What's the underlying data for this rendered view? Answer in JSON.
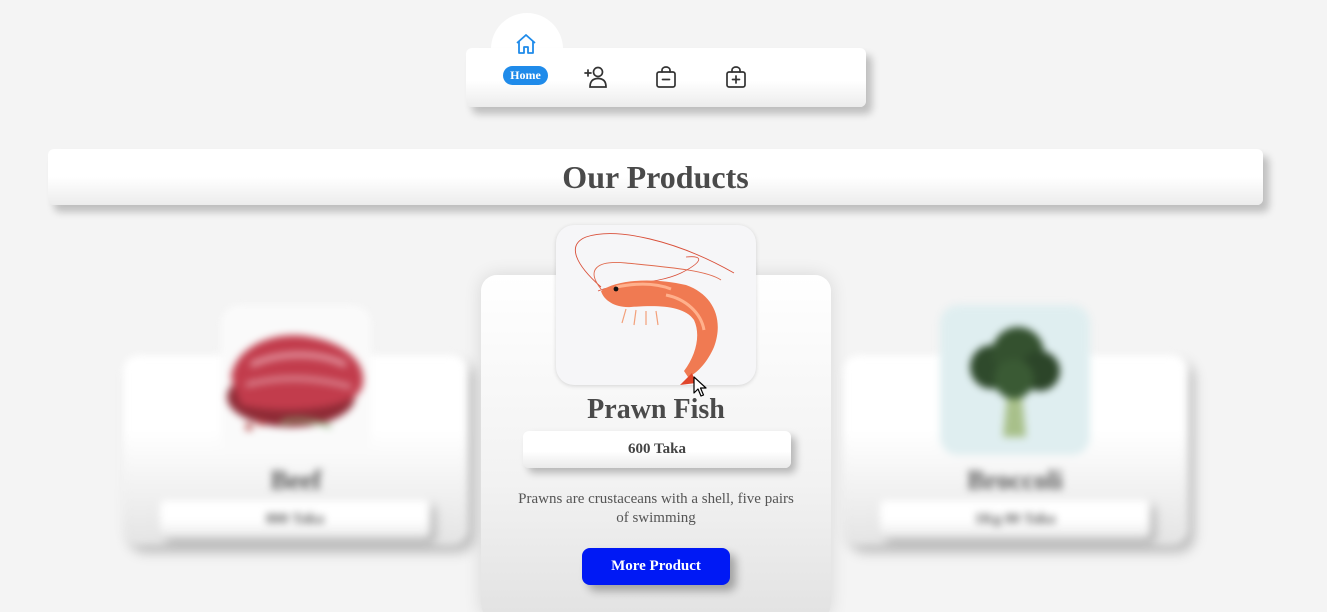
{
  "nav": {
    "home_label": "Home",
    "icons": [
      "home-icon",
      "add-user-icon",
      "bag-minus-icon",
      "bag-plus-icon"
    ],
    "active_color": "#1f8bea"
  },
  "heading": {
    "title": "Our Products"
  },
  "products": [
    {
      "name": "Beef",
      "price": "800 Taka",
      "image": "beef-image"
    },
    {
      "name": "Prawn Fish",
      "price": "600 Taka",
      "description": "Prawns are crustaceans with a shell, five pairs of swimming",
      "image": "prawn-image",
      "button_label": "More Product"
    },
    {
      "name": "Broccoli",
      "price": "1Kg 80 Taka",
      "image": "broccoli-image"
    }
  ],
  "colors": {
    "button": "#0019f5",
    "background": "#f4f4f4"
  }
}
